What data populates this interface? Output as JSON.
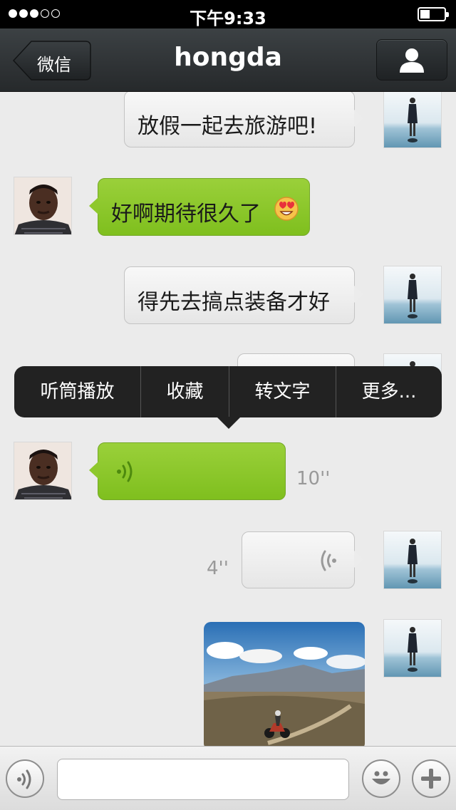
{
  "status_bar": {
    "time": "下午9:33",
    "signal_bars_filled": 3,
    "signal_bars_total": 5,
    "battery_level": 0.4
  },
  "nav": {
    "back_label": "微信",
    "title": "hongda",
    "profile_icon": "person-icon"
  },
  "messages": [
    {
      "sender": "me",
      "type": "text",
      "text": "放假一起去旅游吧!"
    },
    {
      "sender": "hongda",
      "type": "text",
      "text": "好啊期待很久了",
      "emoji": "heart-eyes-emoji"
    },
    {
      "sender": "me",
      "type": "text",
      "text": "得先去搞点装备才好"
    },
    {
      "sender": "me",
      "type": "voice",
      "duration": ""
    },
    {
      "sender": "hongda",
      "type": "voice",
      "duration": "10''"
    },
    {
      "sender": "me",
      "type": "voice",
      "duration": "4''"
    },
    {
      "sender": "me",
      "type": "image",
      "description_icon": "motorcycle-photo"
    }
  ],
  "context_menu": {
    "items": [
      "听筒播放",
      "收藏",
      "转文字",
      "更多..."
    ]
  },
  "input_bar": {
    "voice_icon": "voice-mode-icon",
    "text_value": "",
    "emoji_icon": "smiley-icon",
    "more_icon": "plus-icon"
  },
  "colors": {
    "nav_bg": "#2e3235",
    "my_bubble": "#f1f1f1",
    "their_bubble": "#8ec82c",
    "chat_bg": "#ebebeb"
  }
}
